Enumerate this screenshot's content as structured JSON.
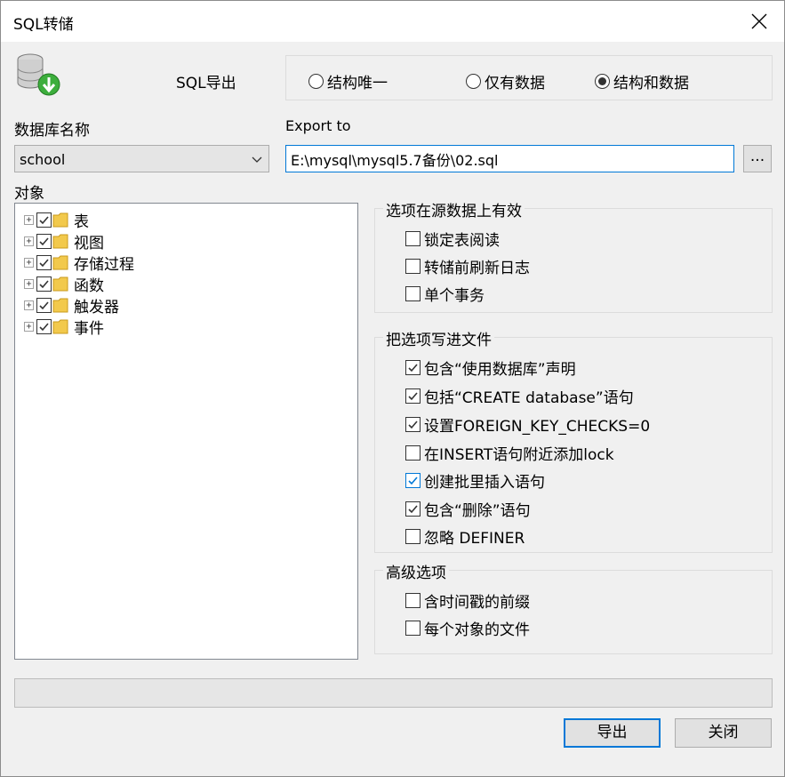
{
  "window": {
    "title": "SQL转储"
  },
  "header": {
    "sql_export_label": "SQL导出"
  },
  "mode": {
    "options": [
      {
        "label": "结构唯一",
        "selected": false
      },
      {
        "label": "仅有数据",
        "selected": false
      },
      {
        "label": "结构和数据",
        "selected": true
      }
    ]
  },
  "database": {
    "label": "数据库名称",
    "selected": "school"
  },
  "export": {
    "label": "Export to",
    "path": "E:\\mysql\\mysql5.7备份\\02.sql",
    "browse_label": "..."
  },
  "objects": {
    "label": "对象",
    "items": [
      {
        "label": "表",
        "checked": true
      },
      {
        "label": "视图",
        "checked": true
      },
      {
        "label": "存储过程",
        "checked": true
      },
      {
        "label": "函数",
        "checked": true
      },
      {
        "label": "触发器",
        "checked": true
      },
      {
        "label": "事件",
        "checked": true
      }
    ]
  },
  "source_options": {
    "title": "选项在源数据上有效",
    "items": [
      {
        "label": "锁定表阅读",
        "checked": false
      },
      {
        "label": "转储前刷新日志",
        "checked": false
      },
      {
        "label": "单个事务",
        "checked": false
      }
    ]
  },
  "file_options": {
    "title": "把选项写进文件",
    "items": [
      {
        "label": "包含“使用数据库”声明",
        "checked": true
      },
      {
        "label": "包括“CREATE database”语句",
        "checked": true
      },
      {
        "label": "设置FOREIGN_KEY_CHECKS=0",
        "checked": true
      },
      {
        "label": "在INSERT语句附近添加lock",
        "checked": false
      },
      {
        "label": "创建批里插入语句",
        "checked": true
      },
      {
        "label": "包含“删除”语句",
        "checked": true
      },
      {
        "label": "忽略 DEFINER",
        "checked": false
      }
    ]
  },
  "advanced_options": {
    "title": "高级选项",
    "items": [
      {
        "label": "含时间戳的前缀",
        "checked": false
      },
      {
        "label": "每个对象的文件",
        "checked": false
      }
    ]
  },
  "buttons": {
    "export": "导出",
    "close": "关闭"
  }
}
